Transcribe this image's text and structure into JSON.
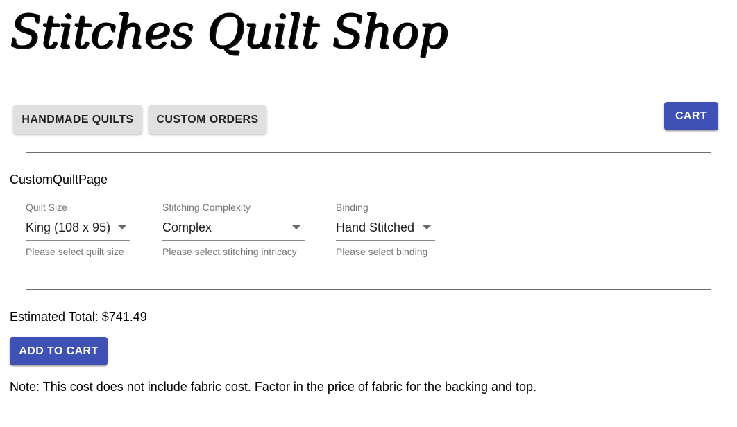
{
  "header": {
    "logo_text": "Stitches Quilt Shop"
  },
  "nav": {
    "handmade_label": "HANDMADE QUILTS",
    "custom_label": "CUSTOM ORDERS",
    "cart_label": "CART"
  },
  "page": {
    "name": "CustomQuiltPage"
  },
  "fields": {
    "size": {
      "label": "Quilt Size",
      "value": "King (108 x 95)",
      "helper": "Please select quilt size"
    },
    "stitching": {
      "label": "Stitching Complexity",
      "value": "Complex",
      "helper": "Please select stitching intricacy"
    },
    "binding": {
      "label": "Binding",
      "value": "Hand Stitched",
      "helper": "Please select binding"
    }
  },
  "summary": {
    "total_text": "Estimated Total: $741.49",
    "add_to_cart_label": "ADD TO CART",
    "note": "Note: This cost does not include fabric cost. Factor in the price of fabric for the backing and top."
  },
  "colors": {
    "primary": "#3f51b5",
    "secondary_button": "#e0e0e0"
  }
}
